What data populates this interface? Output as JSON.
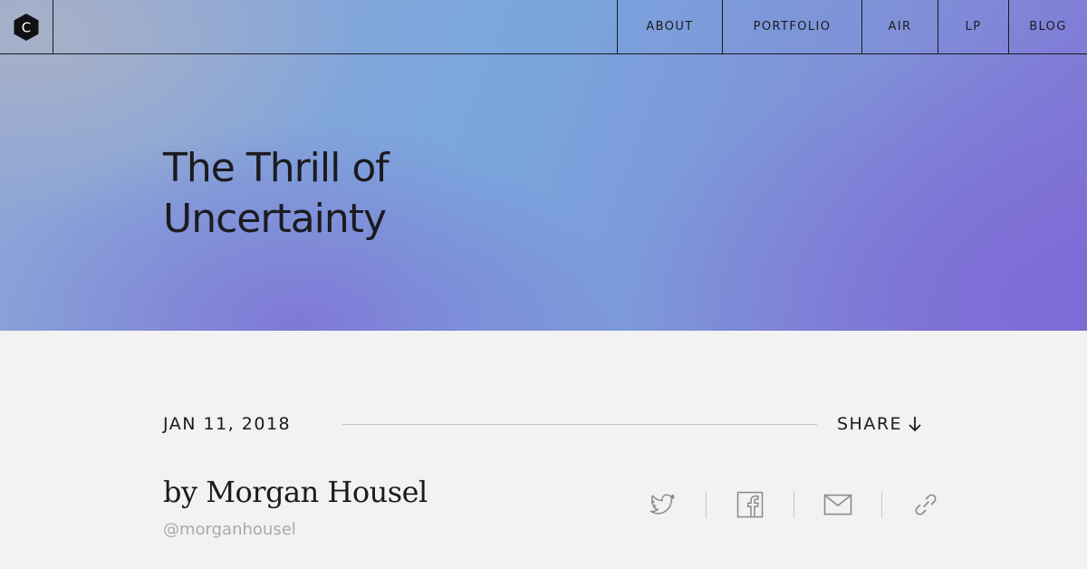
{
  "brand": {
    "logo_letter": "C"
  },
  "nav": {
    "items": [
      {
        "label": "ABOUT"
      },
      {
        "label": "PORTFOLIO"
      },
      {
        "label": "AIR"
      },
      {
        "label": "LP"
      },
      {
        "label": "BLOG"
      }
    ]
  },
  "hero": {
    "title_line1": "The Thrill of",
    "title_line2": "Uncertainty"
  },
  "meta": {
    "date": "JAN 11, 2018",
    "share_label": "SHARE"
  },
  "author": {
    "byline": "by Morgan Housel",
    "handle": "@morganhousel"
  },
  "share_icons": [
    "twitter-icon",
    "facebook-icon",
    "email-icon",
    "link-icon"
  ],
  "colors": {
    "text": "#1b1b1f",
    "muted": "#a9a9a9",
    "page_bg": "#f2f2f2",
    "hero_blue": "#7aa6dc",
    "hero_purple": "#8072d6",
    "icon_gray": "#8a8a8a"
  }
}
